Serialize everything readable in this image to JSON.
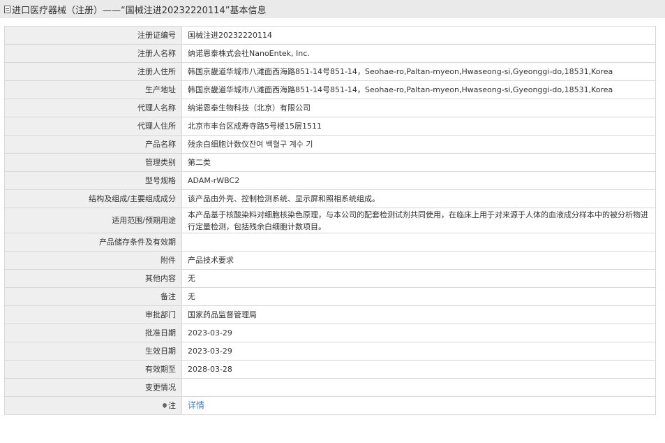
{
  "header": {
    "title": "进口医疗器械（注册）——“国械注进20232220114”基本信息",
    "icon": "document-icon"
  },
  "rows": [
    {
      "label": "注册证编号",
      "value": "国械注进20232220114"
    },
    {
      "label": "注册人名称",
      "value": "纳诺恩泰株式会社NanoEntek, Inc."
    },
    {
      "label": "注册人住所",
      "value": "韩国京畿道华城市八滩面西海路851-14号851-14，Seohae-ro,Paltan-myeon,Hwaseong-si,Gyeonggi-do,18531,Korea"
    },
    {
      "label": "生产地址",
      "value": "韩国京畿道华城市八滩面西海路851-14号851-14，Seohae-ro,Paltan-myeon,Hwaseong-si,Gyeonggi-do,18531,Korea"
    },
    {
      "label": "代理人名称",
      "value": "纳诺恩泰生物科技（北京）有限公司"
    },
    {
      "label": "代理人住所",
      "value": "北京市丰台区成寿寺路5号楼15层1511"
    },
    {
      "label": "产品名称",
      "value": "残余白细胞计数仪잔여 백혈구 계수 기"
    },
    {
      "label": "管理类别",
      "value": "第二类"
    },
    {
      "label": "型号规格",
      "value": "ADAM-rWBC2"
    },
    {
      "label": "结构及组成/主要组成成分",
      "value": "该产品由外壳、控制检测系统、显示屏和照相系统组成。"
    },
    {
      "label": "适用范围/预期用途",
      "value": "本产品基于核酸染料对细胞核染色原理，与本公司的配套检测试剂共同使用，在临床上用于对来源于人体的血液成分样本中的被分析物进行定量检测，包括残余白细胞计数项目。"
    },
    {
      "label": "产品储存条件及有效期",
      "value": ""
    },
    {
      "label": "附件",
      "value": "产品技术要求"
    },
    {
      "label": "其他内容",
      "value": "无"
    },
    {
      "label": "备注",
      "value": "无"
    },
    {
      "label": "审批部门",
      "value": "国家药品监督管理局"
    },
    {
      "label": "批准日期",
      "value": "2023-03-29"
    },
    {
      "label": "生效日期",
      "value": "2023-03-29"
    },
    {
      "label": "有效期至",
      "value": "2028-03-28"
    },
    {
      "label": "变更情况",
      "value": ""
    }
  ],
  "note": {
    "label": "注",
    "icon": "pin-icon",
    "link_text": "详情",
    "link_color": "#3b7fc4"
  }
}
